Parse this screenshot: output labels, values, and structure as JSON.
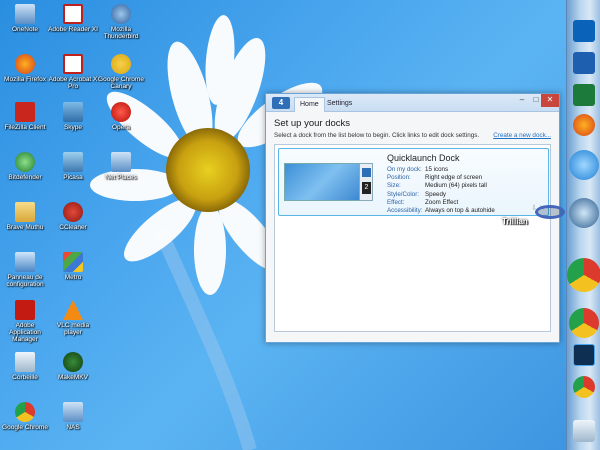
{
  "desktop": {
    "icons": [
      {
        "label": "OneNote",
        "icon": "computer-icon"
      },
      {
        "label": "Adobe Reader XI",
        "icon": "pdf-icon"
      },
      {
        "label": "Mozilla Thunderbird",
        "icon": "thunderbird-icon"
      },
      {
        "label": "Mozilla Firefox",
        "icon": "firefox-icon"
      },
      {
        "label": "Adobe Acrobat X Pro",
        "icon": "pdf-icon"
      },
      {
        "label": "Google Chrome Canary",
        "icon": "chrome-canary-icon"
      },
      {
        "label": "FileZilla Client",
        "icon": "filezilla-icon"
      },
      {
        "label": "Skype",
        "icon": "network-icon"
      },
      {
        "label": "Opera",
        "icon": "opera-icon"
      },
      {
        "label": "Bitdefender",
        "icon": "globe-icon"
      },
      {
        "label": "Picasa",
        "icon": "network-icon"
      },
      {
        "label": "Net Places",
        "icon": "computer-icon"
      },
      {
        "label": "Brave Muthu",
        "icon": "folder-icon"
      },
      {
        "label": "CCleaner",
        "icon": "ccleaner-icon"
      },
      {
        "label": "Panneau de configuration",
        "icon": "control-panel-icon"
      },
      {
        "label": "Metro",
        "icon": "shield-icon"
      },
      {
        "label": "Adobe Application Manager",
        "icon": "adobe-icon"
      },
      {
        "label": "VLC media player",
        "icon": "vlc-icon"
      },
      {
        "label": "Corbeille",
        "icon": "recycle-bin-icon"
      },
      {
        "label": "MakeMKV",
        "icon": "mkv-icon"
      },
      {
        "label": "Google Chrome",
        "icon": "chrome-icon"
      },
      {
        "label": "NAS",
        "icon": "computer-icon"
      }
    ]
  },
  "dialog": {
    "logo": "4",
    "tabs": [
      {
        "label": "Home"
      },
      {
        "label": "Settings"
      }
    ],
    "heading": "Set up your docks",
    "instruction": "Select a dock from the list below to begin. Click links to edit dock settings.",
    "create_link": "Create a new dock...",
    "dock": {
      "name": "Quicklaunch Dock",
      "preview_badge": "2",
      "properties": [
        {
          "key": "On my dock:",
          "value": "15 icons"
        },
        {
          "key": "Position:",
          "value": "Right edge of screen"
        },
        {
          "key": "Size:",
          "value": "Medium (64) pixels tall"
        },
        {
          "key": "Style/Color:",
          "value": "Speedy"
        },
        {
          "key": "Effect:",
          "value": "Zoom Effect"
        },
        {
          "key": "Accessibility:",
          "value": "Always on top & autohide"
        }
      ]
    },
    "window_buttons": {
      "minimize": "–",
      "maximize": "□",
      "close": "✕"
    }
  },
  "dock_bar": {
    "hover_label": "Trillian",
    "icons": [
      "outlook-icon",
      "word-icon",
      "excel-icon",
      "firefox-icon",
      "ie-icon",
      "trillian-icon",
      "chrome-icon",
      "chrome-icon",
      "photoshop-icon",
      "chrome-icon",
      "recycle-bin-icon"
    ]
  }
}
